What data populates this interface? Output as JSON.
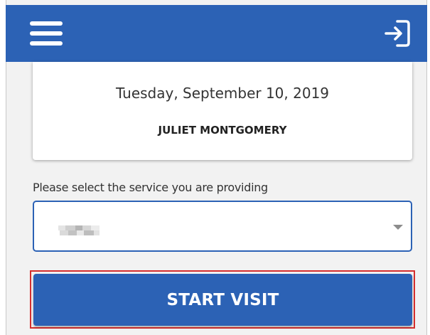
{
  "header": {
    "background_color": "#2c62b5",
    "menu_icon": "hamburger-menu-icon",
    "logout_icon": "sign-out-arrow-icon"
  },
  "visit_card": {
    "date": "Tuesday, September 10, 2019",
    "client_name": "JULIET MONTGOMERY"
  },
  "service_select": {
    "label": "Please select the service you are providing",
    "selected_value_obscured": true,
    "dropdown_icon": "caret-down-icon",
    "border_color": "#2c62b5"
  },
  "start_button": {
    "label": "START VISIT",
    "background_color": "#2c62b5",
    "focus_outline_color": "#d42e2e"
  }
}
